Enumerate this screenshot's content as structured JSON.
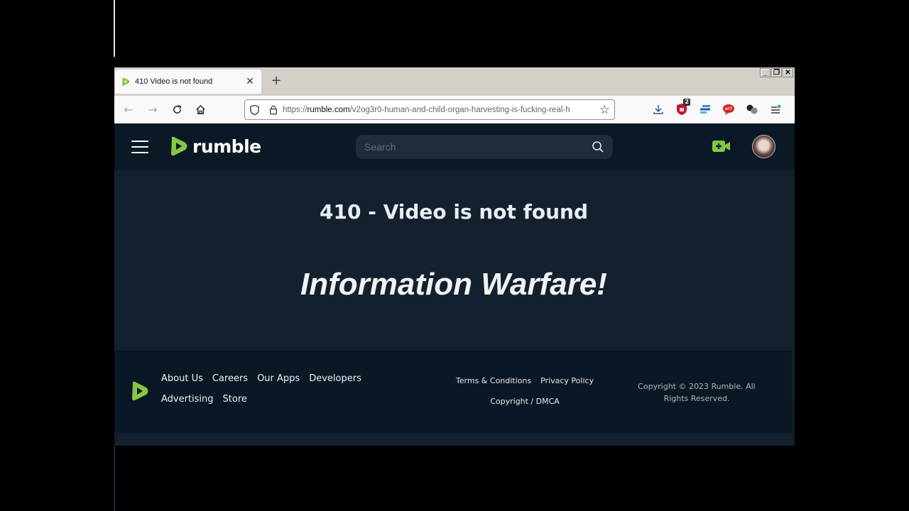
{
  "browser": {
    "tab": {
      "title": "410 Video is not found",
      "close_icon": "close-icon"
    },
    "new_tab_icon": "plus-icon",
    "window_controls": [
      "minimize",
      "restore",
      "close"
    ],
    "window_control_glyphs": [
      "_",
      "❐",
      "✕"
    ],
    "nav": {
      "back_icon": "arrow-left-icon",
      "forward_icon": "arrow-right-icon",
      "reload_icon": "reload-icon",
      "home_icon": "home-icon"
    },
    "url": {
      "scheme": "https://",
      "host": "rumble.com",
      "path": "/v2og3r0-human-and-child-organ-harvesting-is-fucking-real-h"
    },
    "extensions": [
      {
        "name": "downloads",
        "badge": ""
      },
      {
        "name": "ublock",
        "badge": "2"
      },
      {
        "name": "extension-blue",
        "badge": ""
      },
      {
        "name": "extension-red",
        "badge": ""
      },
      {
        "name": "extension-gray",
        "badge": ""
      },
      {
        "name": "menu",
        "badge": ""
      }
    ]
  },
  "site": {
    "brand": "rumble",
    "accent": "#85c742",
    "search": {
      "placeholder": "Search",
      "value": ""
    }
  },
  "main": {
    "error_title": "410 - Video is not found",
    "overlay_text": "Information Warfare!"
  },
  "footer": {
    "links": [
      "About Us",
      "Careers",
      "Our Apps",
      "Developers",
      "Advertising",
      "Store"
    ],
    "legal": [
      "Terms & Conditions",
      "Privacy Policy",
      "Copyright / DMCA"
    ],
    "copyright": "Copyright © 2023 Rumble. All Rights Reserved."
  }
}
